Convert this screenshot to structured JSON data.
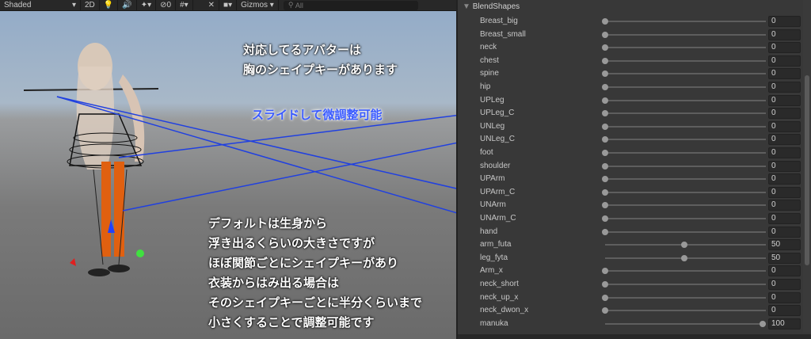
{
  "toolbar": {
    "shading": "Shaded",
    "mode2d": "2D",
    "hidden_count": "0",
    "gizmos": "Gizmos",
    "search_placeholder": "All"
  },
  "overlay": {
    "line1": "対応してるアバターは",
    "line2": "胸のシェイプキーがあります",
    "slide": "スライドして微調整可能",
    "desc": [
      "デフォルトは生身から",
      "浮き出るくらいの大きさですが",
      "ほぼ関節ごとにシェイプキーがあり",
      "衣装からはみ出る場合は",
      "そのシェイプキーごとに半分くらいまで",
      "小さくすることで調整可能です"
    ]
  },
  "panel": {
    "section": "BlendShapes",
    "shapes": [
      {
        "name": "Breast_big",
        "value": "0",
        "pct": 0
      },
      {
        "name": "Breast_small",
        "value": "0",
        "pct": 0
      },
      {
        "name": "neck",
        "value": "0",
        "pct": 0
      },
      {
        "name": "chest",
        "value": "0",
        "pct": 0
      },
      {
        "name": "spine",
        "value": "0",
        "pct": 0
      },
      {
        "name": "hip",
        "value": "0",
        "pct": 0
      },
      {
        "name": "UPLeg",
        "value": "0",
        "pct": 0
      },
      {
        "name": "UPLeg_C",
        "value": "0",
        "pct": 0
      },
      {
        "name": "UNLeg",
        "value": "0",
        "pct": 0
      },
      {
        "name": "UNLeg_C",
        "value": "0",
        "pct": 0
      },
      {
        "name": "foot",
        "value": "0",
        "pct": 0
      },
      {
        "name": "shoulder",
        "value": "0",
        "pct": 0
      },
      {
        "name": "UPArm",
        "value": "0",
        "pct": 0
      },
      {
        "name": "UPArm_C",
        "value": "0",
        "pct": 0
      },
      {
        "name": "UNArm",
        "value": "0",
        "pct": 0
      },
      {
        "name": "UNArm_C",
        "value": "0",
        "pct": 0
      },
      {
        "name": "hand",
        "value": "0",
        "pct": 0
      },
      {
        "name": "arm_futa",
        "value": "50",
        "pct": 50
      },
      {
        "name": "leg_fyta",
        "value": "50",
        "pct": 50
      },
      {
        "name": "Arm_x",
        "value": "0",
        "pct": 0
      },
      {
        "name": "neck_short",
        "value": "0",
        "pct": 0
      },
      {
        "name": "neck_up_x",
        "value": "0",
        "pct": 0
      },
      {
        "name": "neck_dwon_x",
        "value": "0",
        "pct": 0
      },
      {
        "name": "manuka",
        "value": "100",
        "pct": 100
      }
    ]
  }
}
